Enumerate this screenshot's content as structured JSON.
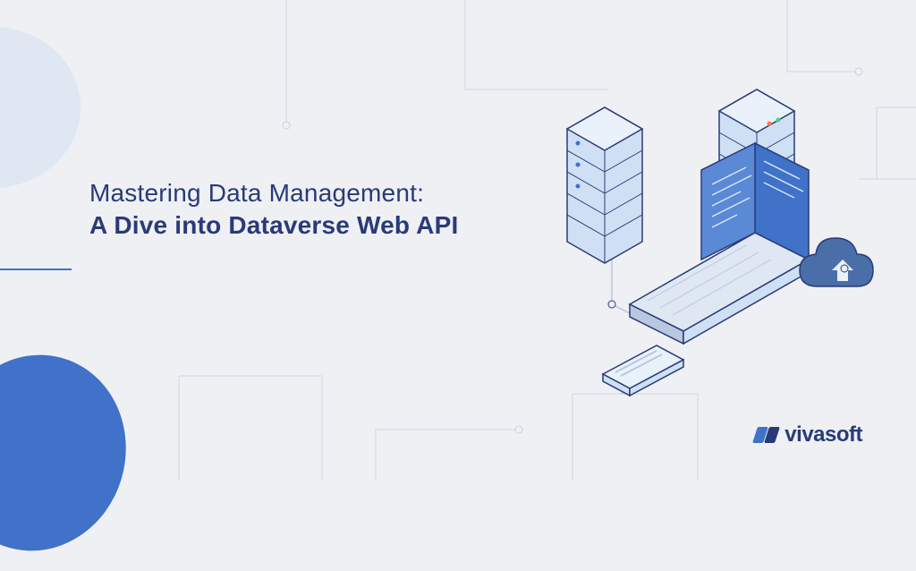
{
  "heading": {
    "line1": "Mastering Data Management:",
    "line2": "A Dive into Dataverse Web API"
  },
  "brand": {
    "name": "vivasoft"
  },
  "colors": {
    "accent": "#3f72c8",
    "dark": "#2a3a78",
    "bg": "#eef0f3",
    "soft": "#dfe7f2"
  },
  "illustration": {
    "elements": [
      "server-tower-left",
      "server-tower-right",
      "laptop",
      "cloud-upload",
      "smartphone"
    ]
  }
}
